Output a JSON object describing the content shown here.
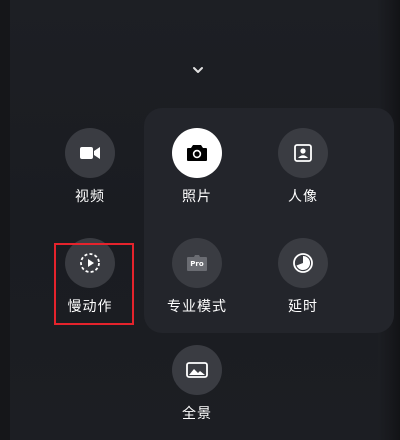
{
  "modes": [
    {
      "label": "视频",
      "icon": "video-camera-icon"
    },
    {
      "label": "照片",
      "icon": "camera-icon",
      "selected": true
    },
    {
      "label": "人像",
      "icon": "portrait-icon"
    },
    {
      "label": "慢动作",
      "icon": "slow-motion-icon"
    },
    {
      "label": "专业模式",
      "icon": "pro-mode-icon",
      "badge": "Pro"
    },
    {
      "label": "延时",
      "icon": "timelapse-icon"
    },
    {
      "label": "全景",
      "icon": "panorama-icon"
    }
  ],
  "colors": {
    "background": "#1b1d22",
    "icon_bg": "#3a3c42",
    "icon_fg": "#ffffff",
    "selected_bg": "#ffffff",
    "selected_fg": "#000000",
    "highlight_box": "#e5232c"
  }
}
